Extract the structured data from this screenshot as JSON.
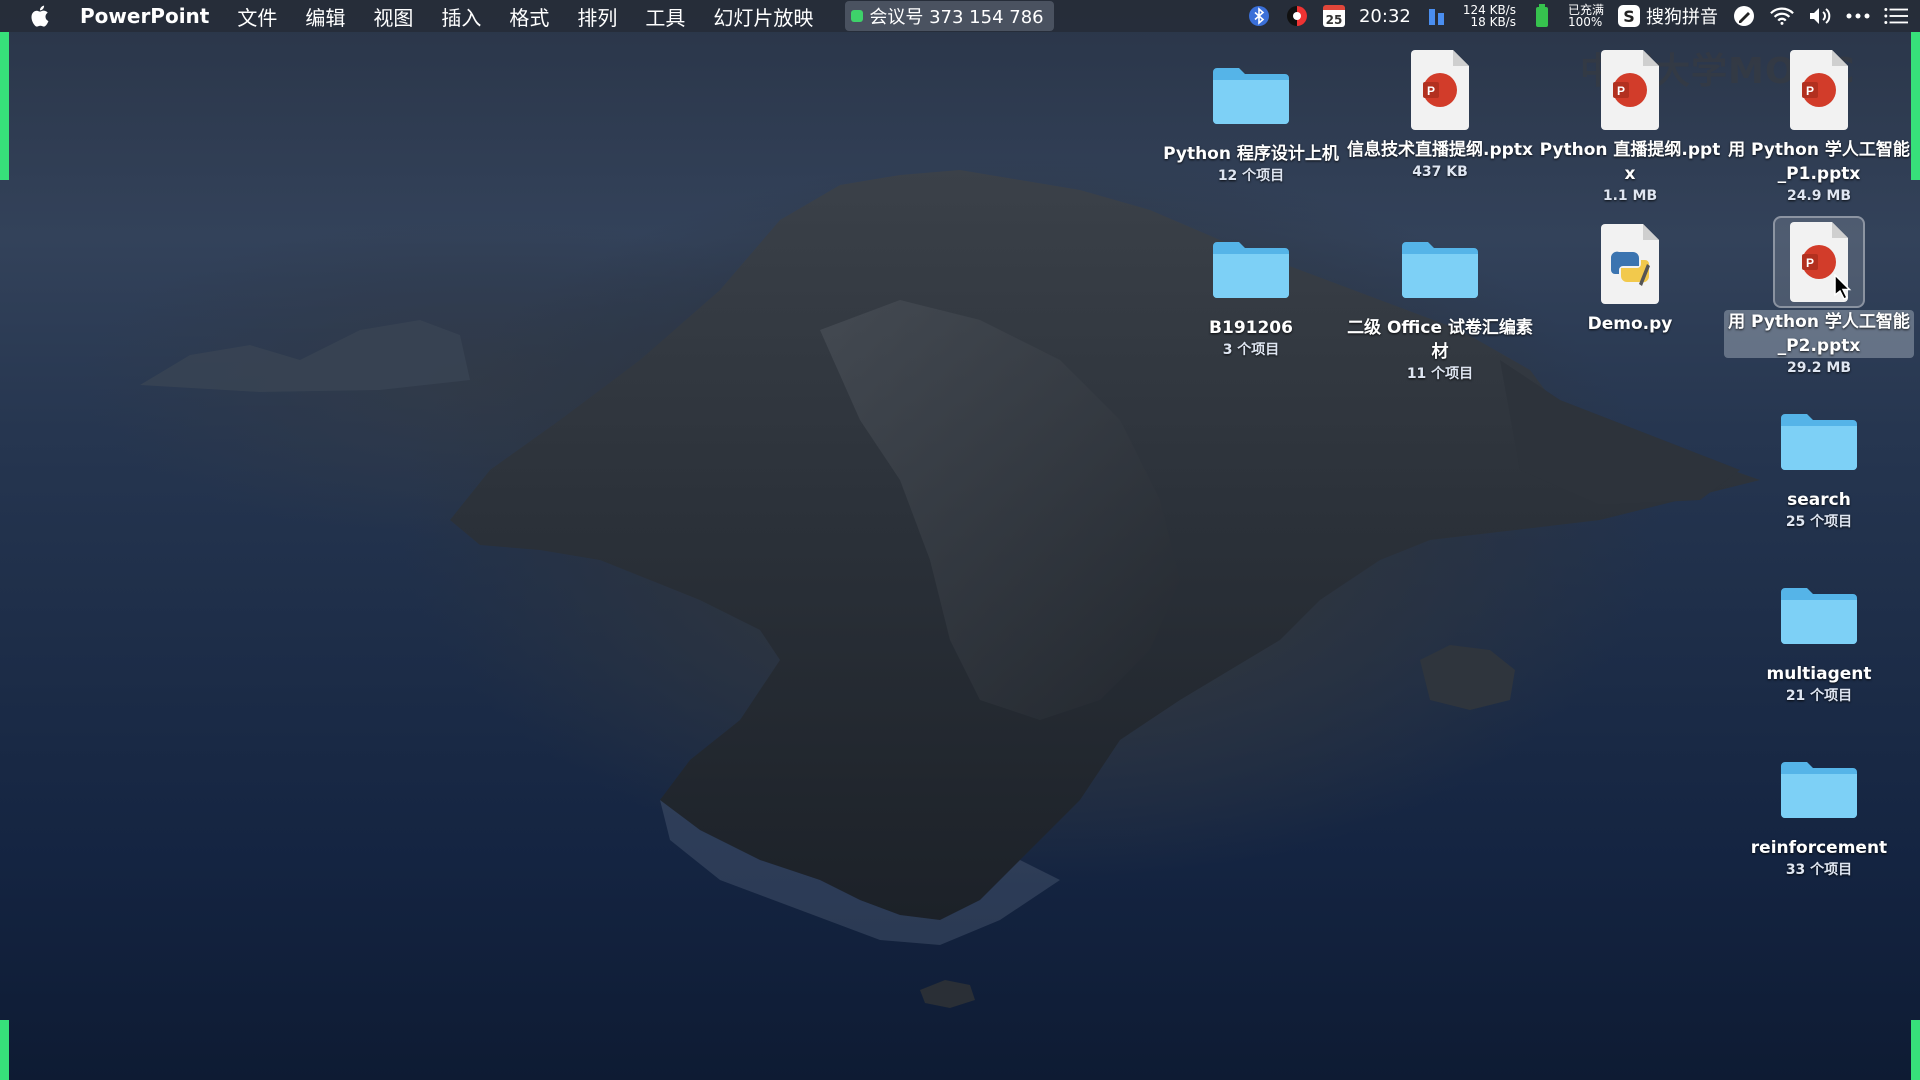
{
  "menubar": {
    "app_name": "PowerPoint",
    "menus": [
      "文件",
      "编辑",
      "视图",
      "插入",
      "格式",
      "排列",
      "工具",
      "幻灯片放映"
    ],
    "meeting": "会议号 373 154 786",
    "calendar_day": "25",
    "time": "20:32",
    "net_up": "124 KB/s",
    "net_down": "18 KB/s",
    "battery_status": "已充满",
    "battery_percent": "100%",
    "input_method": "搜狗拼音",
    "icons": [
      "apple-icon",
      "meeting-indicator-icon",
      "bluetooth-icon",
      "colorsync-icon",
      "calendar-icon",
      "network-speed-icon",
      "battery-icon",
      "sogou-icon",
      "pen-icon",
      "wifi-icon",
      "volume-icon",
      "more-icon",
      "control-center-icon"
    ]
  },
  "watermark": "中国大学MOOC",
  "desktop_items": [
    {
      "id": "python-lab",
      "type": "folder",
      "label": "Python 程序设计上机",
      "sub": "12 个项目"
    },
    {
      "id": "info-tech",
      "type": "pptx",
      "label": "信息技术直播提纲.pptx",
      "sub": "437 KB"
    },
    {
      "id": "python-live",
      "type": "pptx",
      "label": "Python 直播提纲.pptx",
      "sub": "1.1 MB"
    },
    {
      "id": "ai-p1",
      "type": "pptx",
      "label": "用 Python 学人工智能_P1.pptx",
      "sub": "24.9 MB"
    },
    {
      "id": "b191206",
      "type": "folder",
      "label": "B191206",
      "sub": "3 个项目"
    },
    {
      "id": "office-exam",
      "type": "folder",
      "label": "二级 Office 试卷汇编素材",
      "sub": "11 个项目"
    },
    {
      "id": "demo-py",
      "type": "py",
      "label": "Demo.py",
      "sub": ""
    },
    {
      "id": "ai-p2",
      "type": "pptx",
      "label": "用 Python 学人工智能_P2.pptx",
      "sub": "29.2 MB",
      "selected": true
    },
    {
      "id": "search",
      "type": "folder",
      "label": "search",
      "sub": "25 个项目"
    },
    {
      "id": "multiagent",
      "type": "folder",
      "label": "multiagent",
      "sub": "21 个项目"
    },
    {
      "id": "reinforcement",
      "type": "folder",
      "label": "reinforcement",
      "sub": "33 个项目"
    }
  ],
  "colors": {
    "folder": "#6ec6f2",
    "ppt_red": "#d23c2a",
    "menubar_bg": "#262c38",
    "edge_green": "#37e07a"
  }
}
